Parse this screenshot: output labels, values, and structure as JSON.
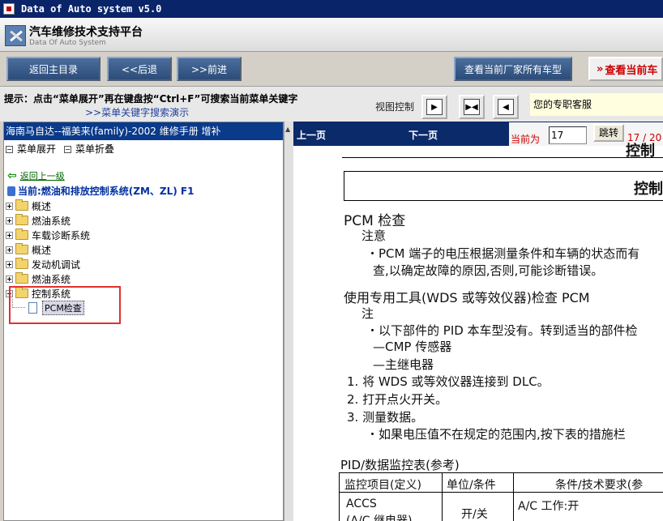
{
  "window": {
    "title": "Data of Auto system v5.0"
  },
  "header": {
    "title": "汽车维修技术支持平台",
    "subtitle": "Data Of Auto System"
  },
  "toolbar": {
    "home": "返回主目录",
    "back": "<<后退",
    "forward": ">>前进",
    "all_models": "查看当前厂家所有车型",
    "current_model": "查看当前车"
  },
  "hint": {
    "text": "提示：点击“菜单展开”再在键盘按“Ctrl+F”可搜索当前菜单关键字",
    "demo_link": ">>菜单关键字搜索演示",
    "view_control": "视图控制",
    "service": "您的专职客服"
  },
  "left": {
    "title": "海南马自达--福美来(family)-2002 维修手册 增补",
    "expand": "菜单展开",
    "collapse": "菜单折叠",
    "back_link": "返回上一级",
    "current": "当前:燃油和排放控制系统(ZM、ZL) F1",
    "tree": [
      {
        "label": "概述",
        "expanded": false
      },
      {
        "label": "燃油系统",
        "expanded": false
      },
      {
        "label": "车载诊断系统",
        "expanded": false
      },
      {
        "label": "概述",
        "expanded": false
      },
      {
        "label": "发动机调试",
        "expanded": false
      },
      {
        "label": "燃油系统",
        "expanded": false
      },
      {
        "label": "控制系统",
        "expanded": true
      }
    ],
    "selected_child": "PCM检查"
  },
  "pager": {
    "prev": "上一页",
    "next": "下一页",
    "current_label": "当前为",
    "page_value": "17",
    "go": "跳转",
    "page_count": "17 / 20"
  },
  "document": {
    "top_cut": "控制",
    "box_title": "控制",
    "h1": "PCM 检查",
    "note1": "注意",
    "note1_line1": "・PCM 端子的电压根据测量条件和车辆的状态而有",
    "note1_line2": "查,以确定故障的原因,否则,可能诊断错误。",
    "h2": "使用专用工具(WDS 或等效仪器)检查 PCM",
    "note2": "注",
    "note2_line1": "・以下部件的 PID 本车型没有。转到适当的部件检",
    "note2_line2": "—CMP 传感器",
    "note2_line3": "—主继电器",
    "step1": "1. 将 WDS 或等效仪器连接到 DLC。",
    "step2": "2. 打开点火开关。",
    "step3": "3. 测量数据。",
    "step3_sub": "・如果电压值不在规定的范围内,按下表的措施栏",
    "table_title": "PID/数据监控表(参考)",
    "table_headers": [
      "监控项目(定义)",
      "单位/条件",
      "条件/技术要求(参"
    ],
    "row1": [
      "ACCS",
      "(A/C 继电器)",
      "开/关",
      "A/C 工作:开"
    ]
  }
}
